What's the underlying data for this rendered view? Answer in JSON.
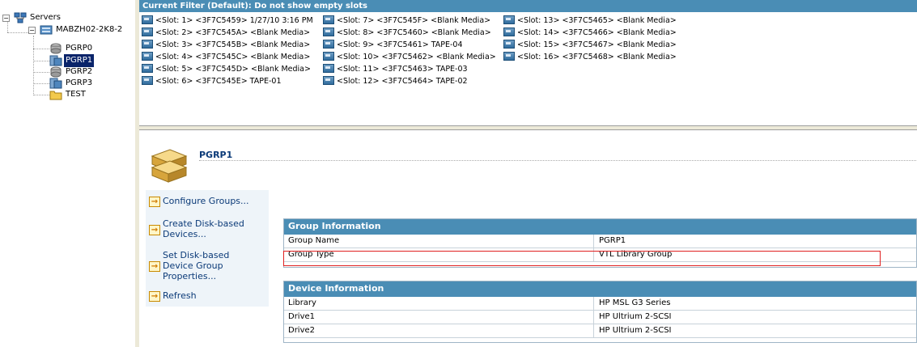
{
  "tree": {
    "root": "Servers",
    "server": "MABZH02-2K8-2",
    "groups": [
      {
        "label": "PGRP0",
        "icon": "library-icon"
      },
      {
        "label": "PGRP1",
        "icon": "library-group-icon",
        "selected": true
      },
      {
        "label": "PGRP2",
        "icon": "library-icon"
      },
      {
        "label": "PGRP3",
        "icon": "library-group-icon"
      },
      {
        "label": "TEST",
        "icon": "folder-icon"
      }
    ]
  },
  "slots": {
    "header": "Current Filter (Default):  Do not show empty slots",
    "columns": [
      [
        "<Slot: 1> <3F7C5459> 1/27/10 3:16 PM",
        "<Slot: 2> <3F7C545A> <Blank Media>",
        "<Slot: 3> <3F7C545B> <Blank Media>",
        "<Slot: 4> <3F7C545C> <Blank Media>",
        "<Slot: 5> <3F7C545D> <Blank Media>",
        "<Slot: 6> <3F7C545E> TAPE-01"
      ],
      [
        "<Slot: 7> <3F7C545F> <Blank Media>",
        "<Slot: 8> <3F7C5460> <Blank Media>",
        "<Slot: 9> <3F7C5461> TAPE-04",
        "<Slot: 10> <3F7C5462> <Blank Media>",
        "<Slot: 11> <3F7C5463> TAPE-03",
        "<Slot: 12> <3F7C5464> TAPE-02"
      ],
      [
        "<Slot: 13> <3F7C5465> <Blank Media>",
        "<Slot: 14> <3F7C5466> <Blank Media>",
        "<Slot: 15> <3F7C5467> <Blank Media>",
        "<Slot: 16> <3F7C5468> <Blank Media>"
      ]
    ]
  },
  "detail": {
    "title": "PGRP1",
    "actions": [
      "Configure Groups...",
      "Create Disk-based Devices...",
      "Set Disk-based Device Group Properties...",
      "Refresh"
    ],
    "group_info": {
      "header": "Group Information",
      "rows": [
        {
          "label": "Group Name",
          "value": "PGRP1"
        },
        {
          "label": "Group Type",
          "value": "VTL Library Group"
        }
      ]
    },
    "device_info": {
      "header": "Device Information",
      "rows": [
        {
          "label": "Library",
          "value": "HP MSL G3 Series"
        },
        {
          "label": "Drive1",
          "value": "HP Ultrium 2-SCSI"
        },
        {
          "label": "Drive2",
          "value": "HP Ultrium 2-SCSI"
        }
      ]
    }
  }
}
